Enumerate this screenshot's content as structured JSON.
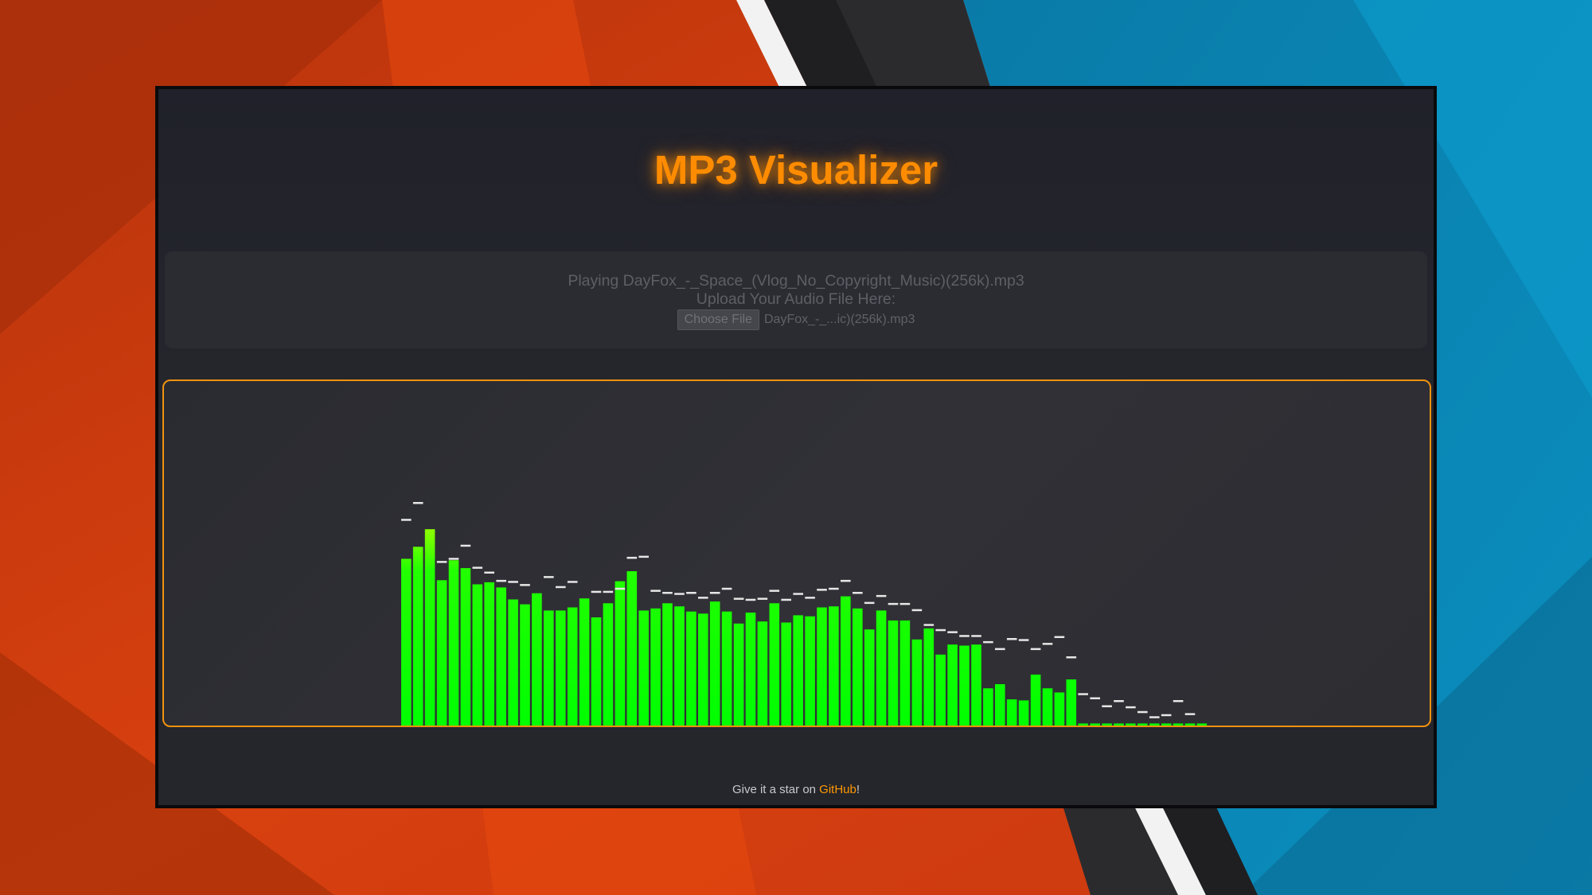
{
  "app": {
    "title": "MP3 Visualizer",
    "accent_color": "#ff8c00",
    "bar_colors": {
      "bottom": "#00ff00",
      "top": "#ddff00"
    },
    "peak_color": "#e6e6e6"
  },
  "upload": {
    "now_playing": "Playing DayFox_-_Space_(Vlog_No_Copyright_Music)(256k).mp3",
    "label": "Upload Your Audio File Here:",
    "choose_file_label": "Choose File",
    "selected_file": "DayFox_-_...ic)(256k).mp3"
  },
  "spectrum": {
    "bar_levels": [
      0.484,
      0.519,
      0.57,
      0.422,
      0.48,
      0.457,
      0.41,
      0.416,
      0.401,
      0.366,
      0.352,
      0.384,
      0.334,
      0.334,
      0.343,
      0.369,
      0.314,
      0.355,
      0.419,
      0.448,
      0.334,
      0.34,
      0.355,
      0.346,
      0.331,
      0.325,
      0.36,
      0.331,
      0.296,
      0.328,
      0.302,
      0.355,
      0.299,
      0.32,
      0.317,
      0.343,
      0.346,
      0.375,
      0.34,
      0.279,
      0.334,
      0.305,
      0.305,
      0.25,
      0.282,
      0.206,
      0.235,
      0.232,
      0.235,
      0.108,
      0.12,
      0.076,
      0.073,
      0.148,
      0.108,
      0.096,
      0.134,
      0.006,
      0.006,
      0.006,
      0.006,
      0.006,
      0.006,
      0.006,
      0.006,
      0.006,
      0.006,
      0.006
    ],
    "peak_levels": [
      0.593,
      0.642,
      null,
      0.471,
      0.48,
      0.518,
      0.454,
      0.44,
      0.416,
      0.413,
      0.404,
      null,
      0.427,
      0.398,
      0.413,
      null,
      0.384,
      0.384,
      0.393,
      0.483,
      0.486,
      0.387,
      0.381,
      0.378,
      0.381,
      0.367,
      0.381,
      0.393,
      0.364,
      0.361,
      0.364,
      0.387,
      0.361,
      0.378,
      0.367,
      0.39,
      0.393,
      0.416,
      0.381,
      0.352,
      0.372,
      0.349,
      0.349,
      0.331,
      0.288,
      0.273,
      0.267,
      0.256,
      0.256,
      0.238,
      0.218,
      0.247,
      0.244,
      0.218,
      0.233,
      0.253,
      0.194,
      0.087,
      0.075,
      0.052,
      0.067,
      0.049,
      0.035,
      0.02,
      0.026,
      0.067,
      0.029
    ]
  },
  "footer": {
    "prefix": "Give it a star on ",
    "link_label": "GitHub",
    "suffix": "!"
  }
}
